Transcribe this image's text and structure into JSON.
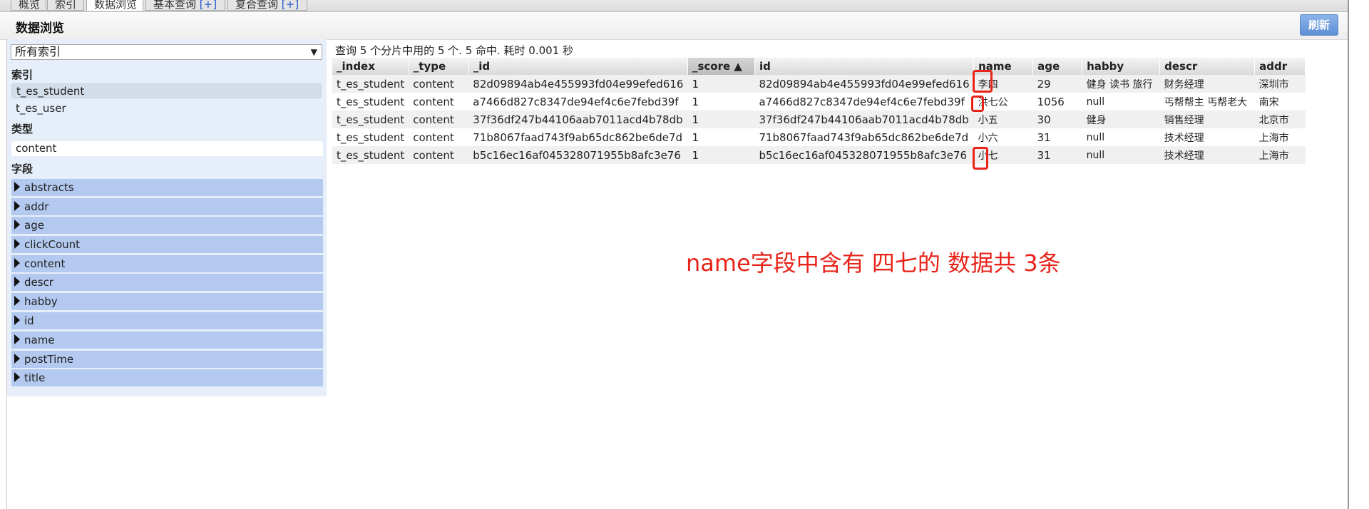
{
  "tabs": [
    {
      "label": "概览",
      "plus": ""
    },
    {
      "label": "索引",
      "plus": ""
    },
    {
      "label": "数据浏览",
      "plus": ""
    },
    {
      "label": "基本查询",
      "plus": "[+]"
    },
    {
      "label": "复合查询",
      "plus": "[+]"
    }
  ],
  "header": {
    "title": "数据浏览",
    "refresh_label": "刷新"
  },
  "sidebar": {
    "index_select": "所有索引",
    "index_label": "索引",
    "indices": [
      "t_es_student",
      "t_es_user"
    ],
    "type_label": "类型",
    "types": [
      "content"
    ],
    "fields_label": "字段",
    "fields": [
      "abstracts",
      "addr",
      "age",
      "clickCount",
      "content",
      "descr",
      "habby",
      "id",
      "name",
      "postTime",
      "title"
    ]
  },
  "results": {
    "summary": "查询 5 个分片中用的 5 个. 5 命中. 耗时 0.001 秒",
    "columns": [
      "_index",
      "_type",
      "_id",
      "_score ▲",
      "id",
      "name",
      "age",
      "habby",
      "descr",
      "addr"
    ],
    "rows": [
      [
        "t_es_student",
        "content",
        "82d09894ab4e455993fd04e99efed616",
        "1",
        "82d09894ab4e455993fd04e99efed616",
        "李四",
        "29",
        "健身 读书 旅行",
        "财务经理",
        "深圳市"
      ],
      [
        "t_es_student",
        "content",
        "a7466d827c8347de94ef4c6e7febd39f",
        "1",
        "a7466d827c8347de94ef4c6e7febd39f",
        "洪七公",
        "1056",
        "null",
        "丐帮帮主 丐帮老大",
        "南宋"
      ],
      [
        "t_es_student",
        "content",
        "37f36df247b44106aab7011acd4b78db",
        "1",
        "37f36df247b44106aab7011acd4b78db",
        "小五",
        "30",
        "健身",
        "销售经理",
        "北京市"
      ],
      [
        "t_es_student",
        "content",
        "71b8067faad743f9ab65dc862be6de7d",
        "1",
        "71b8067faad743f9ab65dc862be6de7d",
        "小六",
        "31",
        "null",
        "技术经理",
        "上海市"
      ],
      [
        "t_es_student",
        "content",
        "b5c16ec16af045328071955b8afc3e76",
        "1",
        "b5c16ec16af045328071955b8afc3e76",
        "小七",
        "31",
        "null",
        "技术经理",
        "上海市"
      ]
    ]
  },
  "annotation": "name字段中含有 四七的 数据共 3条",
  "colors": {
    "annotation": "#e8231a",
    "field_bg": "#b3c9f0",
    "sidebar_bg": "#e6eef9",
    "button": "#6e9be0"
  }
}
